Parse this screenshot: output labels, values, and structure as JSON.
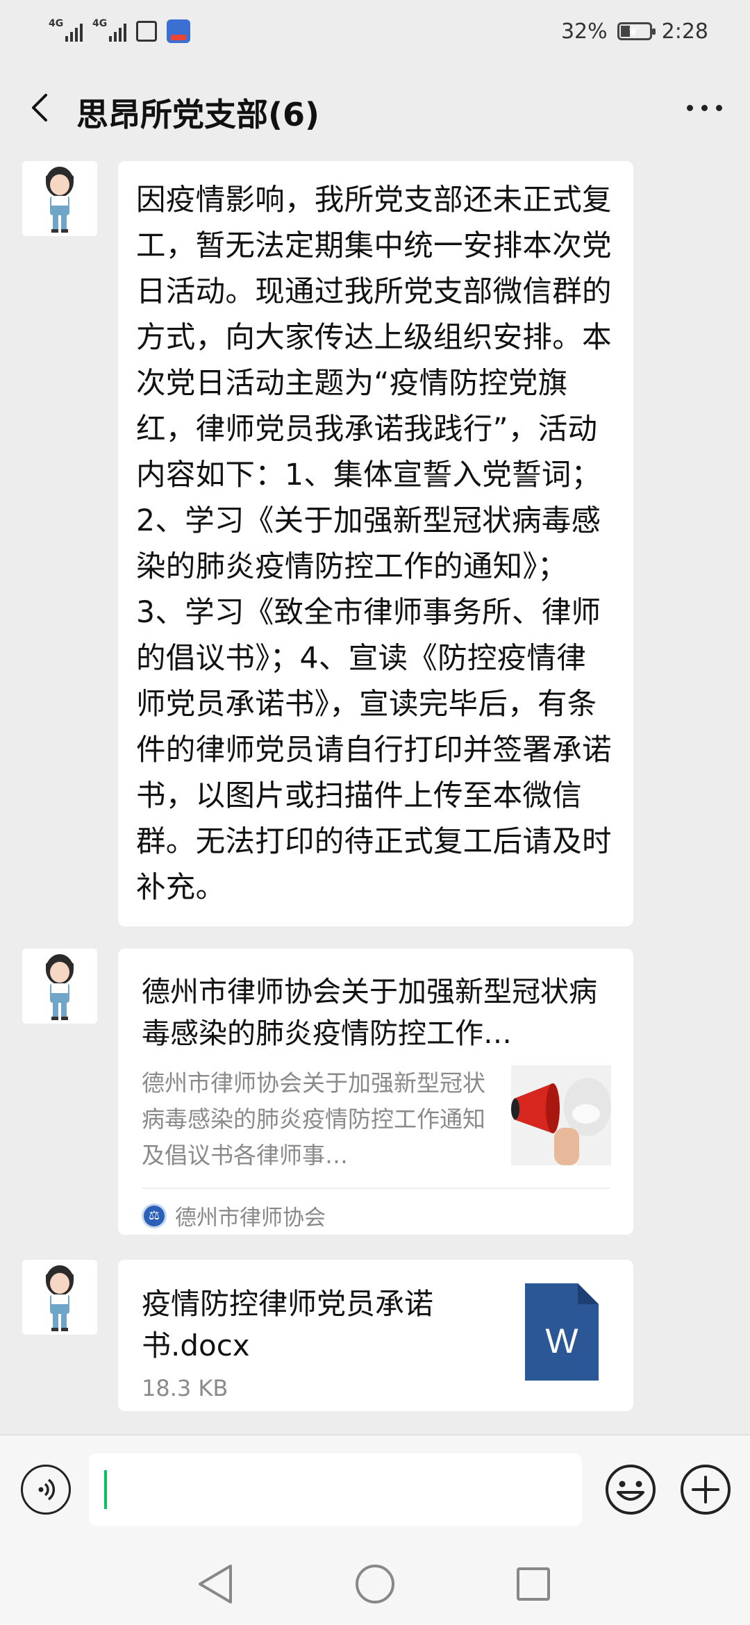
{
  "status_bar": {
    "signal1_label": "4G",
    "signal2_label": "4G",
    "battery_percent": "32%",
    "battery_level": 0.32,
    "time": "2:28"
  },
  "header": {
    "title": "思昂所党支部(6)"
  },
  "messages": [
    {
      "type": "text",
      "text": "因疫情影响，我所党支部还未正式复工，暂无法定期集中统一安排本次党日活动。现通过我所党支部微信群的方式，向大家传达上级组织安排。本次党日活动主题为“疫情防控党旗红，律师党员我承诺我践行”，活动内容如下：1、集体宣誓入党誓词；2、学习《关于加强新型冠状病毒感染的肺炎疫情防控工作的通知》；3、学习《致全市律师事务所、律师的倡议书》；4、宣读《防控疫情律师党员承诺书》，宣读完毕后，有条件的律师党员请自行打印并签署承诺书，以图片或扫描件上传至本微信群。无法打印的待正式复工后请及时补充。"
    },
    {
      "type": "link",
      "title": "德州市律师协会关于加强新型冠状病毒感染的肺炎疫情防控工作…",
      "description": "德州市律师协会关于加强新型冠状病毒感染的肺炎疫情防控工作通知及倡议书各律师事…",
      "source": "德州市律师协会"
    },
    {
      "type": "file",
      "file_name": "疫情防控律师党员承诺书.docx",
      "file_size": "18.3 KB",
      "file_icon_letter": "W"
    }
  ],
  "icons": {
    "back": "chevron-left-icon",
    "more": "more-dots-icon",
    "voice": "voice-icon",
    "emoji": "emoji-icon",
    "plus": "plus-icon"
  },
  "colors": {
    "background": "#ededed",
    "bubble": "#ffffff",
    "word_blue": "#2b5797",
    "cursor": "#07c160"
  }
}
